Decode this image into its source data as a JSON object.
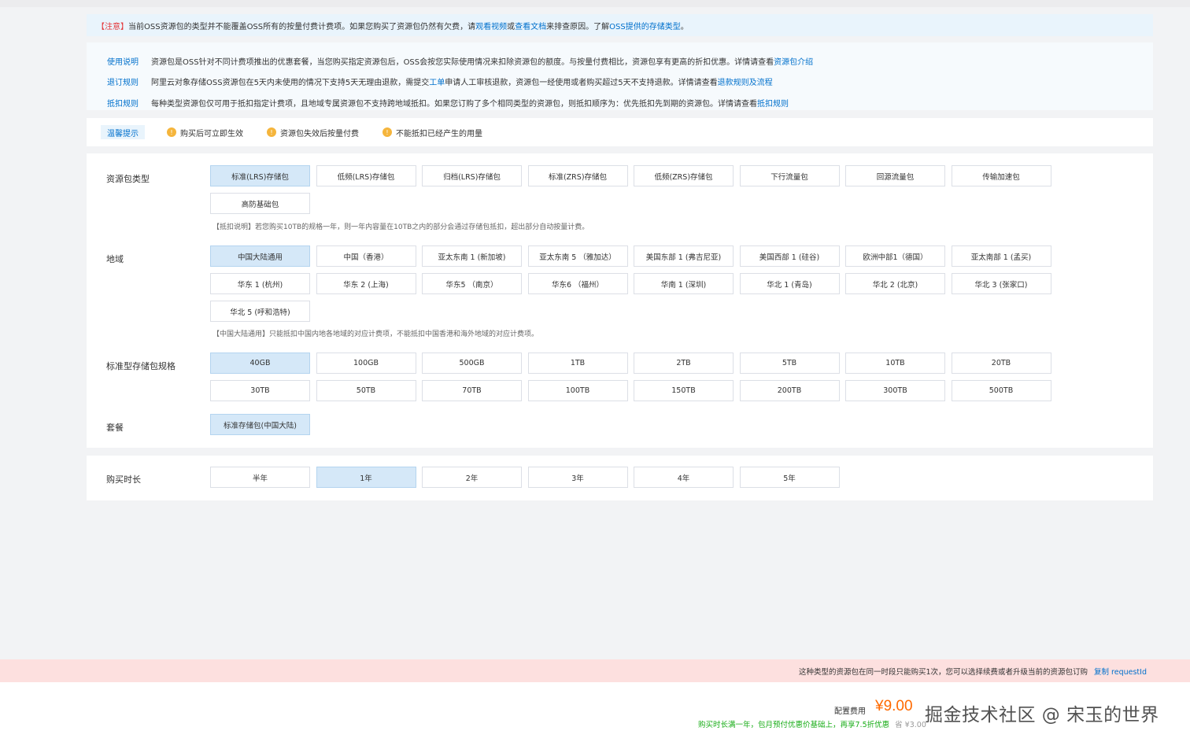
{
  "notice": {
    "warn": "【注意】",
    "text1": "当前OSS资源包的类型并不能覆盖OSS所有的按量付费计费项。如果您购买了资源包仍然有欠费，请",
    "link1": "观看视频",
    "or": "或",
    "link2": "查看文档",
    "text2": "来排查原因。了解",
    "link3": "OSS提供的存储类型",
    "end": "。"
  },
  "info": [
    {
      "label": "使用说明",
      "text": "资源包是OSS针对不同计费项推出的优惠套餐，当您购买指定资源包后，OSS会按您实际使用情况来扣除资源包的额度。与按量付费相比，资源包享有更高的折扣优惠。详情请查看",
      "link": "资源包介绍",
      "tail": ""
    },
    {
      "label": "退订规则",
      "text": "阿里云对象存储OSS资源包在5天内未使用的情况下支持5天无理由退款，需提交",
      "link": "工单",
      "tail": "申请人工审核退款，资源包一经使用或者购买超过5天不支持退款。详情请查看",
      "link2": "退款规则及流程"
    },
    {
      "label": "抵扣规则",
      "text": "每种类型资源包仅可用于抵扣指定计费项，且地域专属资源包不支持跨地域抵扣。如果您订购了多个相同类型的资源包，则抵扣顺序为：优先抵扣先到期的资源包。详情请查看",
      "link": "抵扣规则",
      "tail": ""
    }
  ],
  "tips": {
    "label": "温馨提示",
    "items": [
      "购买后可立即生效",
      "资源包失效后按量付费",
      "不能抵扣已经产生的用量"
    ]
  },
  "package_type": {
    "label": "资源包类型",
    "options": [
      "标准(LRS)存储包",
      "低频(LRS)存储包",
      "归档(LRS)存储包",
      "标准(ZRS)存储包",
      "低频(ZRS)存储包",
      "下行流量包",
      "回源流量包",
      "传输加速包",
      "高防基础包"
    ],
    "selected": 0,
    "note": "【抵扣说明】若您购买10TB的规格一年，则一年内容量在10TB之内的部分会通过存储包抵扣，超出部分自动按量计费。"
  },
  "region": {
    "label": "地域",
    "options": [
      "中国大陆通用",
      "中国（香港）",
      "亚太东南 1 (新加坡)",
      "亚太东南 5 （雅加达）",
      "美国东部 1 (弗吉尼亚)",
      "美国西部 1 (硅谷)",
      "欧洲中部1（德国）",
      "亚太南部 1 (孟买)",
      "华东 1 (杭州)",
      "华东 2 (上海)",
      "华东5 （南京）",
      "华东6 （福州）",
      "华南 1 (深圳)",
      "华北 1 (青岛)",
      "华北 2 (北京)",
      "华北 3 (张家口)",
      "华北 5 (呼和浩特)"
    ],
    "selected": 0,
    "note": "【中国大陆通用】只能抵扣中国内地各地域的对应计费项，不能抵扣中国香港和海外地域的对应计费项。"
  },
  "spec": {
    "label": "标准型存储包规格",
    "options": [
      "40GB",
      "100GB",
      "500GB",
      "1TB",
      "2TB",
      "5TB",
      "10TB",
      "20TB",
      "30TB",
      "50TB",
      "70TB",
      "100TB",
      "150TB",
      "200TB",
      "300TB",
      "500TB"
    ],
    "selected": 0
  },
  "plan": {
    "label": "套餐",
    "options": [
      "标准存储包(中国大陆)"
    ],
    "selected": 0
  },
  "duration": {
    "label": "购买时长",
    "options": [
      "半年",
      "1年",
      "2年",
      "3年",
      "4年",
      "5年"
    ],
    "selected": 1
  },
  "error": {
    "text": "这种类型的资源包在同一时段只能购买1次，您可以选择续费或者升级当前的资源包订购",
    "copy": "复制",
    "request": "requestId"
  },
  "footer": {
    "fee_label": "配置费用",
    "price": "¥9.00",
    "watermark": "掘金技术社区 @ 宋玉的世界",
    "promo": "购买时长满一年，包月预付优惠价基础上，再享7.5折优惠",
    "save": "省 ¥3.00"
  },
  "colors": {
    "accent": "#0070cc",
    "selected_bg": "#d5e8f8",
    "price": "#ff6a00",
    "error_bg": "#fde0df",
    "promo": "#1aad19"
  }
}
